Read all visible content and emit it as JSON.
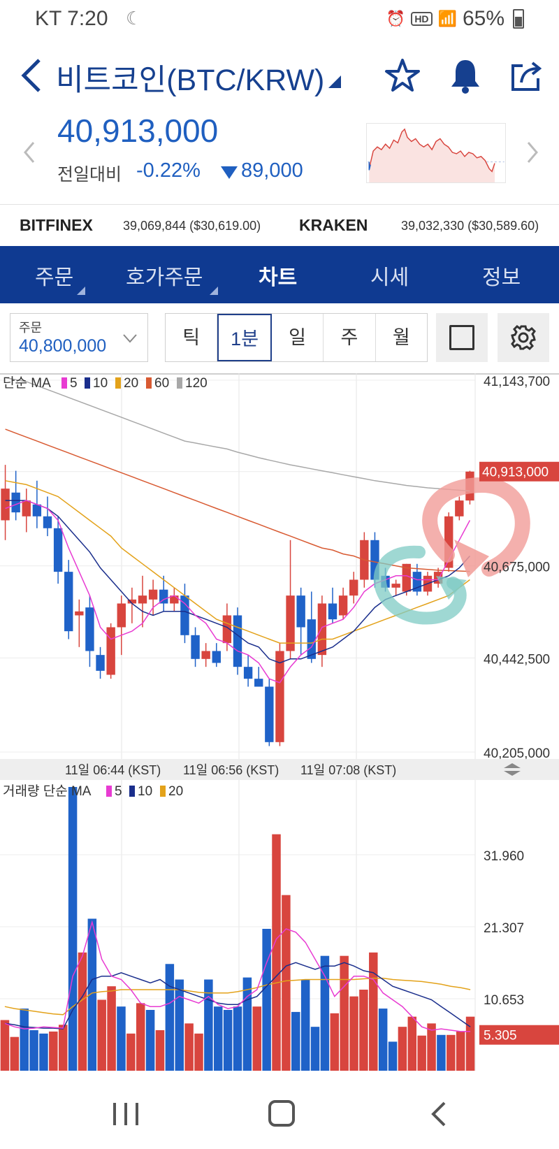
{
  "status_bar": {
    "carrier_time": "KT 7:20",
    "battery": "65%",
    "hd": "HD"
  },
  "header": {
    "title": "비트코인(BTC/KRW)"
  },
  "price": {
    "current": "40,913,000",
    "change_label": "전일대비",
    "change_pct": "-0.22%",
    "change_abs": "89,000"
  },
  "exchanges": [
    {
      "name": "BITFINEX",
      "value": "39,069,844 ($30,619.00)"
    },
    {
      "name": "KRAKEN",
      "value": "39,032,330 ($30,589.60)"
    }
  ],
  "tabs": [
    "주문",
    "호가주문",
    "차트",
    "시세",
    "정보"
  ],
  "active_tab": "차트",
  "toolbar": {
    "order_label": "주문",
    "order_value": "40,800,000",
    "intervals": [
      "틱",
      "1분",
      "일",
      "주",
      "월"
    ],
    "active_interval": "1분"
  },
  "colors": {
    "up": "#d8453e",
    "down": "#1f62c8",
    "brand": "#0f3a91",
    "ma5": "#e83bd2",
    "ma10": "#1a2e8c",
    "ma20": "#e3a21a",
    "ma60": "#d85a32",
    "ma120": "#a8a8a8"
  },
  "chart_data": [
    {
      "type": "candlestick",
      "legend_title": "단순 MA",
      "legend": [
        {
          "period": "5",
          "color": "#e83bd2"
        },
        {
          "period": "10",
          "color": "#1a2e8c"
        },
        {
          "period": "20",
          "color": "#e3a21a"
        },
        {
          "period": "60",
          "color": "#d85a32"
        },
        {
          "period": "120",
          "color": "#a8a8a8"
        }
      ],
      "y_ticks": [
        "41,143,700",
        "40,675,000",
        "40,442,500",
        "40,205,000"
      ],
      "current_price_label": "40,913,000",
      "ylim": [
        40205000,
        41143700
      ],
      "x_labels": [
        "11일 06:44 (KST)",
        "11일 06:56 (KST)",
        "11일 07:08 (KST)"
      ],
      "candles": [
        {
          "o": 40790000,
          "h": 40930000,
          "l": 40740000,
          "c": 40870000
        },
        {
          "o": 40860000,
          "h": 40915000,
          "l": 40790000,
          "c": 40810000
        },
        {
          "o": 40800000,
          "h": 40870000,
          "l": 40760000,
          "c": 40840000
        },
        {
          "o": 40830000,
          "h": 40890000,
          "l": 40770000,
          "c": 40800000
        },
        {
          "o": 40800000,
          "h": 40850000,
          "l": 40750000,
          "c": 40770000
        },
        {
          "o": 40770000,
          "h": 40800000,
          "l": 40630000,
          "c": 40660000
        },
        {
          "o": 40660000,
          "h": 40690000,
          "l": 40490000,
          "c": 40510000
        },
        {
          "o": 40550000,
          "h": 40590000,
          "l": 40470000,
          "c": 40560000
        },
        {
          "o": 40570000,
          "h": 40600000,
          "l": 40420000,
          "c": 40460000
        },
        {
          "o": 40450000,
          "h": 40470000,
          "l": 40390000,
          "c": 40410000
        },
        {
          "o": 40400000,
          "h": 40530000,
          "l": 40390000,
          "c": 40520000
        },
        {
          "o": 40520000,
          "h": 40600000,
          "l": 40450000,
          "c": 40580000
        },
        {
          "o": 40580000,
          "h": 40620000,
          "l": 40530000,
          "c": 40590000
        },
        {
          "o": 40580000,
          "h": 40650000,
          "l": 40520000,
          "c": 40600000
        },
        {
          "o": 40590000,
          "h": 40640000,
          "l": 40550000,
          "c": 40615000
        },
        {
          "o": 40615000,
          "h": 40650000,
          "l": 40560000,
          "c": 40580000
        },
        {
          "o": 40580000,
          "h": 40620000,
          "l": 40560000,
          "c": 40600000
        },
        {
          "o": 40600000,
          "h": 40630000,
          "l": 40480000,
          "c": 40500000
        },
        {
          "o": 40500000,
          "h": 40520000,
          "l": 40420000,
          "c": 40440000
        },
        {
          "o": 40440000,
          "h": 40480000,
          "l": 40420000,
          "c": 40460000
        },
        {
          "o": 40460000,
          "h": 40480000,
          "l": 40420000,
          "c": 40430000
        },
        {
          "o": 40480000,
          "h": 40580000,
          "l": 40460000,
          "c": 40550000
        },
        {
          "o": 40550000,
          "h": 40570000,
          "l": 40400000,
          "c": 40420000
        },
        {
          "o": 40420000,
          "h": 40450000,
          "l": 40370000,
          "c": 40390000
        },
        {
          "o": 40390000,
          "h": 40420000,
          "l": 40370000,
          "c": 40370000
        },
        {
          "o": 40370000,
          "h": 40390000,
          "l": 40220000,
          "c": 40230000
        },
        {
          "o": 40230000,
          "h": 40480000,
          "l": 40220000,
          "c": 40460000
        },
        {
          "o": 40460000,
          "h": 40740000,
          "l": 40440000,
          "c": 40600000
        },
        {
          "o": 40600000,
          "h": 40620000,
          "l": 40450000,
          "c": 40520000
        },
        {
          "o": 40540000,
          "h": 40610000,
          "l": 40430000,
          "c": 40440000
        },
        {
          "o": 40450000,
          "h": 40600000,
          "l": 40420000,
          "c": 40580000
        },
        {
          "o": 40580000,
          "h": 40620000,
          "l": 40530000,
          "c": 40540000
        },
        {
          "o": 40550000,
          "h": 40620000,
          "l": 40540000,
          "c": 40600000
        },
        {
          "o": 40600000,
          "h": 40660000,
          "l": 40580000,
          "c": 40640000
        },
        {
          "o": 40640000,
          "h": 40760000,
          "l": 40620000,
          "c": 40740000
        },
        {
          "o": 40740000,
          "h": 40760000,
          "l": 40620000,
          "c": 40640000
        },
        {
          "o": 40650000,
          "h": 40670000,
          "l": 40610000,
          "c": 40620000
        },
        {
          "o": 40620000,
          "h": 40640000,
          "l": 40600000,
          "c": 40630000
        },
        {
          "o": 40610000,
          "h": 40680000,
          "l": 40600000,
          "c": 40680000
        },
        {
          "o": 40660000,
          "h": 40680000,
          "l": 40600000,
          "c": 40610000
        },
        {
          "o": 40610000,
          "h": 40660000,
          "l": 40600000,
          "c": 40650000
        },
        {
          "o": 40630000,
          "h": 40670000,
          "l": 40620000,
          "c": 40660000
        },
        {
          "o": 40670000,
          "h": 40810000,
          "l": 40660000,
          "c": 40800000
        },
        {
          "o": 40800000,
          "h": 40850000,
          "l": 40790000,
          "c": 40840000
        },
        {
          "o": 40840000,
          "h": 40915000,
          "l": 40830000,
          "c": 40913000
        }
      ],
      "ma5": [
        40820000,
        40830000,
        40840000,
        40830000,
        40820000,
        40790000,
        40720000,
        40660000,
        40600000,
        40520000,
        40490000,
        40500000,
        40510000,
        40530000,
        40570000,
        40590000,
        40600000,
        40580000,
        40550000,
        40530000,
        40490000,
        40480000,
        40460000,
        40450000,
        40430000,
        40390000,
        40380000,
        40420000,
        40450000,
        40470000,
        40520000,
        40530000,
        40540000,
        40570000,
        40610000,
        40630000,
        40640000,
        40650000,
        40650000,
        40640000,
        40640000,
        40640000,
        40690000,
        40740000,
        40790000
      ],
      "ma10": [
        40840000,
        40840000,
        40840000,
        40830000,
        40820000,
        40800000,
        40770000,
        40740000,
        40710000,
        40670000,
        40640000,
        40610000,
        40580000,
        40560000,
        40550000,
        40560000,
        40560000,
        40560000,
        40550000,
        40540000,
        40530000,
        40520000,
        40500000,
        40480000,
        40470000,
        40440000,
        40430000,
        40440000,
        40440000,
        40450000,
        40460000,
        40470000,
        40490000,
        40510000,
        40540000,
        40570000,
        40590000,
        40600000,
        40610000,
        40620000,
        40630000,
        40640000,
        40650000,
        40670000,
        40700000
      ],
      "ma20": [
        40890000,
        40885000,
        40880000,
        40870000,
        40860000,
        40850000,
        40830000,
        40810000,
        40790000,
        40770000,
        40750000,
        40720000,
        40700000,
        40680000,
        40660000,
        40640000,
        40620000,
        40600000,
        40580000,
        40560000,
        40540000,
        40530000,
        40520000,
        40510000,
        40500000,
        40490000,
        40480000,
        40480000,
        40480000,
        40480000,
        40490000,
        40490000,
        40500000,
        40510000,
        40520000,
        40530000,
        40540000,
        40550000,
        40560000,
        40570000,
        40580000,
        40590000,
        40600000,
        40620000,
        40640000
      ],
      "ma60": [
        41020000,
        41010000,
        41000000,
        40990000,
        40980000,
        40970000,
        40960000,
        40950000,
        40940000,
        40930000,
        40920000,
        40910000,
        40900000,
        40890000,
        40880000,
        40870000,
        40860000,
        40850000,
        40840000,
        40830000,
        40820000,
        40810000,
        40800000,
        40790000,
        40780000,
        40770000,
        40760000,
        40750000,
        40740000,
        40730000,
        40720000,
        40715000,
        40705000,
        40700000,
        40690000,
        40685000,
        40680000,
        40675000,
        40670000,
        40668000,
        40666000,
        40664000,
        40663000,
        40662000,
        40661000
      ],
      "ma120": [
        41150000,
        41145000,
        41140000,
        41130000,
        41120000,
        41110000,
        41100000,
        41090000,
        41080000,
        41070000,
        41060000,
        41050000,
        41040000,
        41030000,
        41020000,
        41010000,
        41000000,
        40990000,
        40985000,
        40980000,
        40975000,
        40970000,
        40962000,
        40955000,
        40948000,
        40942000,
        40936000,
        40930000,
        40925000,
        40920000,
        40915000,
        40910000,
        40905000,
        40900000,
        40895000,
        40890000,
        40886000,
        40882000,
        40878000,
        40875000,
        40872000,
        40870000,
        40868000,
        40866000,
        40864000
      ]
    },
    {
      "type": "bar",
      "legend_title": "거래량 단순 MA",
      "legend": [
        {
          "period": "5",
          "color": "#e83bd2"
        },
        {
          "period": "10",
          "color": "#1a2e8c"
        },
        {
          "period": "20",
          "color": "#e3a21a"
        }
      ],
      "y_ticks": [
        "31.960",
        "21.307",
        "10.653"
      ],
      "current_value_label": "5.305",
      "ylim": [
        0,
        42
      ],
      "volume": [
        7.5,
        5.0,
        9.2,
        6.0,
        5.5,
        5.8,
        6.8,
        42.0,
        17.5,
        22.5,
        10.5,
        12.5,
        9.5,
        5.5,
        10.0,
        9.0,
        6.0,
        15.8,
        13.5,
        7.0,
        5.5,
        13.5,
        9.5,
        9.0,
        9.5,
        13.8,
        9.5,
        21.0,
        35.0,
        26.0,
        8.7,
        13.5,
        6.5,
        17.0,
        8.5,
        17.0,
        11.0,
        12.0,
        17.5,
        9.2,
        4.3,
        6.5,
        8.0,
        5.2,
        7.0,
        5.3,
        5.3,
        5.8,
        8.0
      ],
      "up": [
        true,
        true,
        false,
        false,
        false,
        true,
        true,
        false,
        true,
        false,
        true,
        true,
        false,
        true,
        true,
        false,
        true,
        false,
        false,
        true,
        true,
        false,
        false,
        false,
        false,
        false,
        true,
        false,
        true,
        true,
        false,
        false,
        false,
        false,
        true,
        true,
        true,
        true,
        true,
        false,
        false,
        true,
        true,
        true,
        true,
        false,
        true,
        true,
        true
      ],
      "ma5": [
        7.0,
        6.5,
        6.2,
        6.3,
        6.5,
        6.4,
        6.3,
        14.0,
        17.0,
        22.0,
        16.5,
        14.0,
        13.5,
        12.0,
        10.0,
        9.5,
        9.5,
        10.0,
        11.0,
        10.5,
        10.0,
        11.0,
        9.8,
        9.2,
        9.5,
        11.0,
        12.0,
        16.0,
        19.5,
        21.0,
        20.5,
        19.0,
        16.5,
        14.0,
        11.0,
        12.5,
        14.0,
        14.0,
        13.5,
        11.5,
        10.5,
        9.5,
        8.0,
        6.5,
        6.0,
        6.2,
        6.0,
        5.8,
        5.8
      ],
      "ma10": [
        7.0,
        6.8,
        6.5,
        6.4,
        6.3,
        6.3,
        6.2,
        9.0,
        11.0,
        13.5,
        14.0,
        14.0,
        14.5,
        14.0,
        13.5,
        13.0,
        13.5,
        12.5,
        12.0,
        11.5,
        11.0,
        10.5,
        10.0,
        9.8,
        9.8,
        10.5,
        11.0,
        12.5,
        14.0,
        15.5,
        16.0,
        15.5,
        15.0,
        15.5,
        15.5,
        16.0,
        15.5,
        14.8,
        14.5,
        13.5,
        12.5,
        12.0,
        11.5,
        11.0,
        10.5,
        9.5,
        8.5,
        7.5,
        6.5
      ],
      "ma20": [
        9.5,
        9.2,
        9.0,
        8.8,
        8.6,
        8.4,
        8.3,
        9.5,
        10.5,
        11.5,
        11.7,
        11.8,
        12.0,
        12.0,
        12.0,
        12.0,
        12.0,
        12.0,
        12.0,
        11.8,
        11.6,
        11.5,
        11.5,
        11.5,
        11.7,
        12.0,
        12.3,
        12.7,
        13.0,
        13.3,
        13.4,
        13.5,
        13.5,
        13.5,
        13.5,
        13.5,
        13.5,
        13.6,
        13.7,
        13.7,
        13.5,
        13.4,
        13.3,
        13.2,
        13.0,
        12.8,
        12.5,
        12.3,
        12.0
      ]
    }
  ],
  "navbar": {
    "items": [
      "recent-apps",
      "home",
      "back"
    ]
  }
}
